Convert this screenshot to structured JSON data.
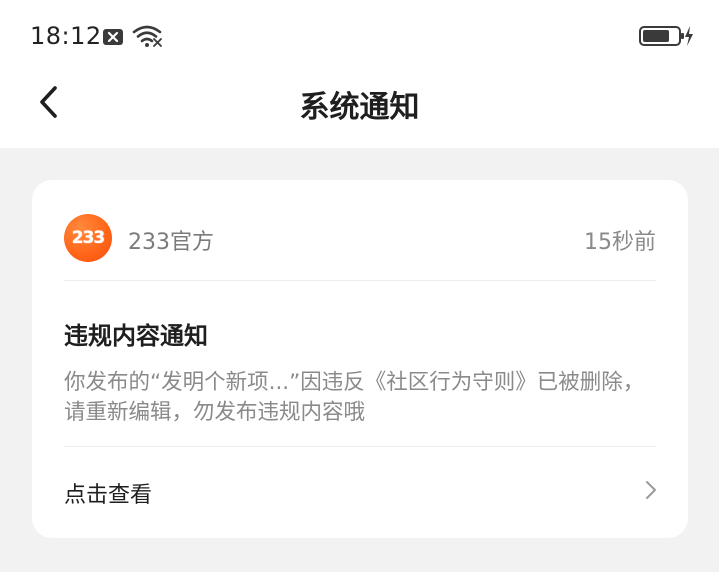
{
  "status_bar": {
    "time": "18:12"
  },
  "nav": {
    "title": "系统通知"
  },
  "notification": {
    "sender": "233官方",
    "avatar_text": "233",
    "timestamp": "15秒前",
    "title": "违规内容通知",
    "body": "你发布的“发明个新项...”因违反《社区行为守则》已被删除，请重新编辑，勿发布违规内容哦",
    "action_label": "点击查看"
  },
  "colors": {
    "accent": "#ff6418",
    "background": "#f2f2f2",
    "card": "#ffffff",
    "muted_text": "#8a8a8a"
  },
  "icons": {
    "back": "chevron-left-icon",
    "notification": "x-box-icon",
    "wifi": "wifi-icon",
    "battery": "battery-charging-icon",
    "action": "chevron-right-icon"
  }
}
